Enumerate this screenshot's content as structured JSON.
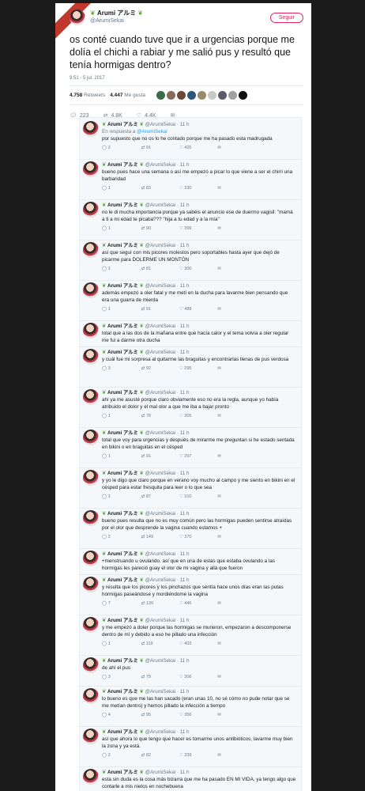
{
  "tweet": {
    "display_name": "Arumi アルミ",
    "handle": "@ArumiSekai",
    "follow_label": "Seguir",
    "text": "os conté cuando tuve que ir a urgencias porque me dolía el chichi a rabiar y me salió pus y resultó que tenía hormigas dentro?",
    "timestamp": "9:51 - 5 jul. 2017",
    "retweets": "4.758",
    "retweets_label": "Retweets",
    "likes": "4.447",
    "likes_label": "Me gusta",
    "reply_count": "223",
    "retweet_count": "4,8K",
    "like_count": "4,4K"
  },
  "replies": [
    {
      "name": "Arumi アルミ",
      "handle": "@ArumiSekai · 11 h",
      "reply_to": "En respuesta a",
      "reply_to_handle": "@ArumiSekai",
      "text": "por supuesto que no os lo he contado porque me ha pasado esta madrugada",
      "r": "2",
      "rt": "91",
      "l": "425"
    },
    {
      "name": "Arumi アルミ",
      "handle": "@ArumiSekai · 11 h",
      "text": "bueno pues hace una semana o así me empezó a picar lo que viene a ser el chirri una barbaridad",
      "r": "1",
      "rt": "83",
      "l": "330"
    },
    {
      "name": "Arumi アルミ",
      "handle": "@ArumiSekai · 11 h",
      "text": "no le di mucha importancia porque ya sabéis el anuncio ese de duermo vagisil: \"mamá a ti a mi edad te picaba??? \"hija a tu edad y a la mía\"",
      "r": "1",
      "rt": "90",
      "l": "399"
    },
    {
      "name": "Arumi アルミ",
      "handle": "@ArumiSekai · 11 h",
      "text": "así que seguí con mis picores molestos pero soportables hasta ayer que dejó de picarme para DOLERME UN MONTÓN",
      "r": "1",
      "rt": "81",
      "l": "300"
    },
    {
      "name": "Arumi アルミ",
      "handle": "@ArumiSekai · 11 h",
      "text": "además empezó a oler fatal y me metí en la ducha para lavarme bien pensando que era una guarra de mierda",
      "r": "1",
      "rt": "91",
      "l": "488"
    },
    {
      "name": "Arumi アルミ",
      "handle": "@ArumiSekai · 11 h",
      "text": "total que a las dos de la mañana entre que hacía calor y el tema volvía a oler regular me fui a darme otra ducha",
      "r": "",
      "rt": "",
      "l": ""
    },
    {
      "name": "Arumi アルミ",
      "handle": "@ArumiSekai · 11 h",
      "text": "y cuál fue mi sorpresa al quitarme las braguitas y encontrarlas llenas de pus verdosa",
      "r": "3",
      "rt": "92",
      "l": "295"
    },
    {
      "name": "Arumi アルミ",
      "handle": "@ArumiSekai · 11 h",
      "text": "ahí ya me asusté porque claro obviamente eso no era la regla, aunque yo había atribuido el dolor y el mal olor a que me iba a bajar pronto",
      "r": "1",
      "rt": "78",
      "l": "305"
    },
    {
      "name": "Arumi アルミ",
      "handle": "@ArumiSekai · 11 h",
      "text": "total que voy para urgencias y después de mirarme me preguntan si he estado sentada en bikini o en braguitas en el césped",
      "r": "1",
      "rt": "91",
      "l": "297"
    },
    {
      "name": "Arumi アルミ",
      "handle": "@ArumiSekai · 11 h",
      "text": "y yo le digo que claro porque en verano voy mucho al campo y me siento en bikini en el césped para estar fresquita para leer o lo que sea",
      "r": "1",
      "rt": "87",
      "l": "310"
    },
    {
      "name": "Arumi アルミ",
      "handle": "@ArumiSekai · 11 h",
      "text": "bueno pues resulta que no es muy común pero las hormigas pueden sentirse atraídas por el olor que desprende la vagina cuando estamos +",
      "r": "2",
      "rt": "149",
      "l": "370"
    },
    {
      "name": "Arumi アルミ",
      "handle": "@ArumiSekai · 11 h",
      "text": "+menstruando u ovulando. así que en una de estas que estaba ovulando a las hormigas les pareció guay el olor de mi vagina y allá que fueron",
      "r": "",
      "rt": "",
      "l": ""
    },
    {
      "name": "Arumi アルミ",
      "handle": "@ArumiSekai · 11 h",
      "text": "y resulta que los picores y los pinchazos que sentía hace unos días eran las putas hormigas paseándose y mordiéndome la vagina",
      "r": "7",
      "rt": "139",
      "l": "446"
    },
    {
      "name": "Arumi アルミ",
      "handle": "@ArumiSekai · 11 h",
      "text": "y me empezó a doler porque las hormigas se murieron, empezaron a descomponerse dentro de mí y debido a eso he pillado una infección",
      "r": "1",
      "rt": "119",
      "l": "403"
    },
    {
      "name": "Arumi アルミ",
      "handle": "@ArumiSekai · 11 h",
      "text": "de ahí el pus",
      "r": "3",
      "rt": "79",
      "l": "306"
    },
    {
      "name": "Arumi アルミ",
      "handle": "@ArumiSekai · 11 h",
      "text": "lo bueno es que me las han sacado (eran unas 10, no sé cómo no pude notar que se me metían dentro) y hemos pillado la infección a tiempo",
      "r": "4",
      "rt": "95",
      "l": "356"
    },
    {
      "name": "Arumi アルミ",
      "handle": "@ArumiSekai · 11 h",
      "text": "así que ahora lo que tengo que hacer es tomarme unos antibióticos, lavarme muy bien la zona y ya está.",
      "r": "2",
      "rt": "82",
      "l": "339"
    },
    {
      "name": "Arumi アルミ",
      "handle": "@ArumiSekai · 11 h",
      "text": "esta sin duda es la cosa más bizarra que me ha pasado EN MI VIDA, ya tengo algo que contarle a mis nietos en nochebuena",
      "r": "",
      "rt": "",
      "l": ""
    }
  ]
}
